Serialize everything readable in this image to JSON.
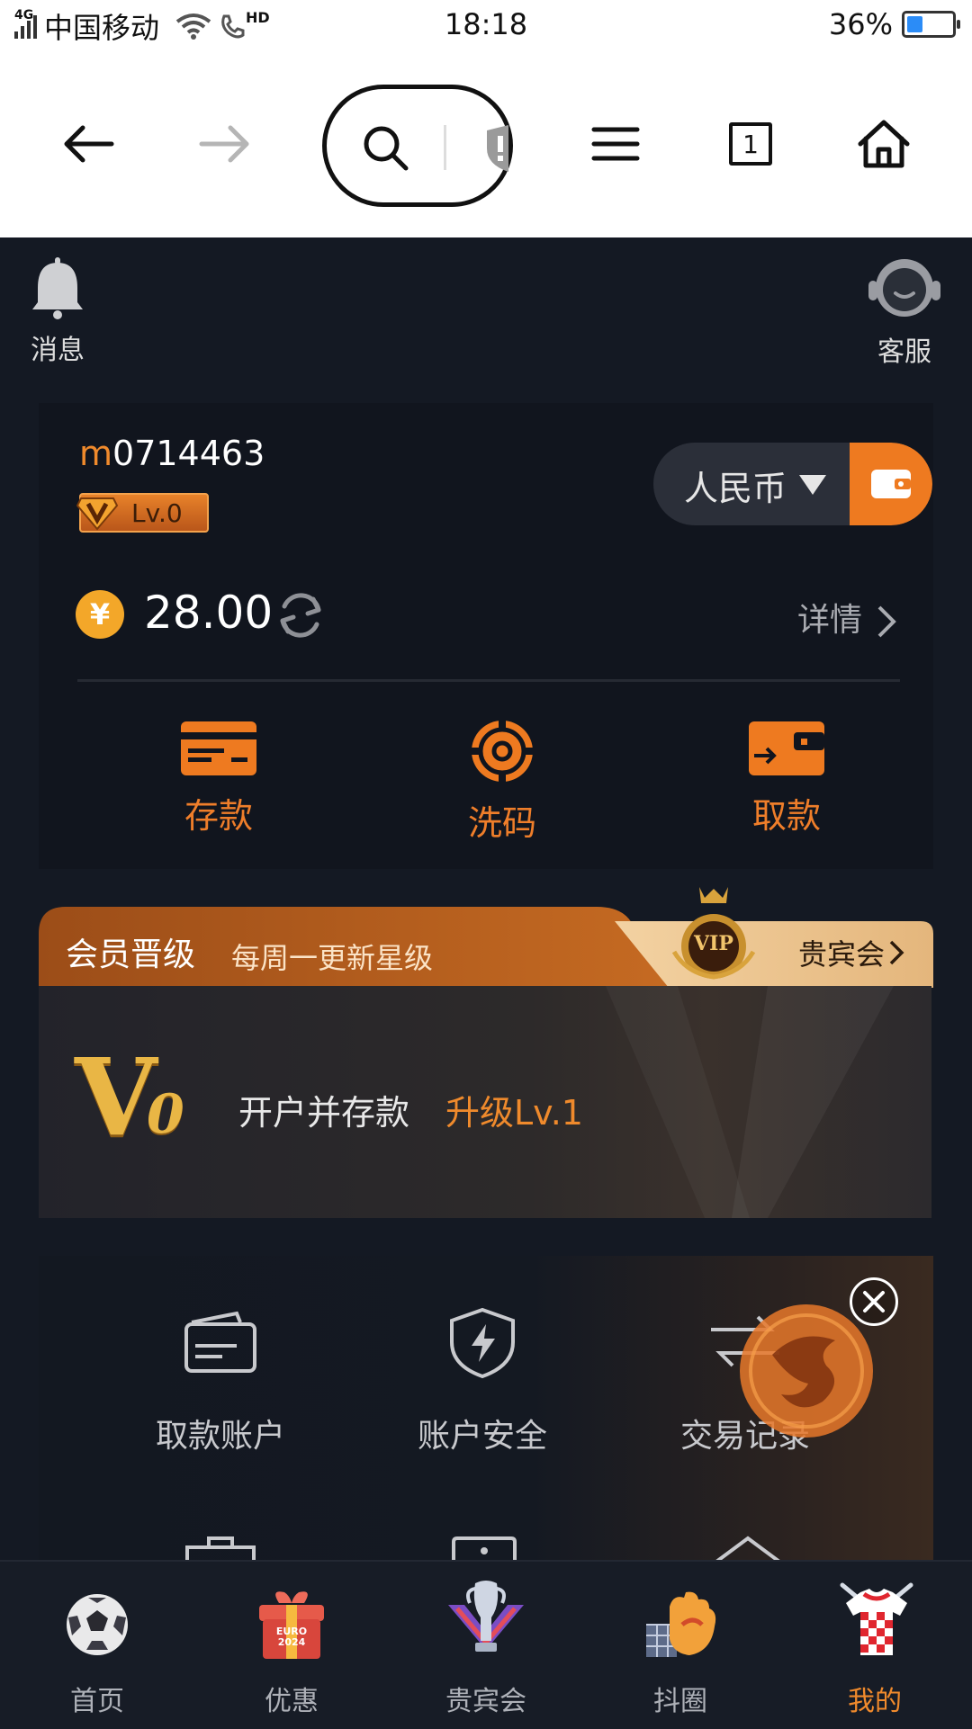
{
  "status_bar": {
    "signal_label": "4G",
    "carrier": "中国移动",
    "hd_label": "HD",
    "time": "18:18",
    "battery_text": "36%",
    "battery_level": 0.36
  },
  "browser": {
    "tab_count": "1"
  },
  "header": {
    "messages_label": "消息",
    "support_label": "客服"
  },
  "account": {
    "username_prefix": "m",
    "username_rest": "0714463",
    "level": "Lv.0",
    "currency": "人民币",
    "balance": "28.00",
    "details_label": "详情",
    "currency_symbol": "¥"
  },
  "actions": [
    {
      "label": "存款",
      "icon": "deposit-card-icon"
    },
    {
      "label": "洗码",
      "icon": "chip-icon"
    },
    {
      "label": "取款",
      "icon": "withdraw-wallet-icon"
    }
  ],
  "vip": {
    "title": "会员晋级",
    "subtitle": "每周一更新星级",
    "club_label": "贵宾会",
    "badge_text": "VIP",
    "level_big": "V",
    "level_digit": "0",
    "requirement": "开户并存款",
    "upgrade": "升级Lv.1"
  },
  "grid": [
    {
      "label": "取款账户",
      "icon": "bank-card-icon"
    },
    {
      "label": "账户安全",
      "icon": "shield-bolt-icon"
    },
    {
      "label": "交易记录",
      "icon": "transfer-record-icon"
    }
  ],
  "bottom_nav": [
    {
      "label": "首页",
      "icon": "soccer-ball-icon",
      "active": false
    },
    {
      "label": "优惠",
      "icon": "gift-box-icon",
      "active": false,
      "badge_text": "EURO 2024"
    },
    {
      "label": "贵宾会",
      "icon": "trophy-icon",
      "active": false
    },
    {
      "label": "抖圈",
      "icon": "goalkeeper-glove-icon",
      "active": false
    },
    {
      "label": "我的",
      "icon": "jersey-icon",
      "active": true
    }
  ],
  "colors": {
    "accent": "#ee7a20",
    "background": "#141923",
    "card": "#11151e"
  }
}
